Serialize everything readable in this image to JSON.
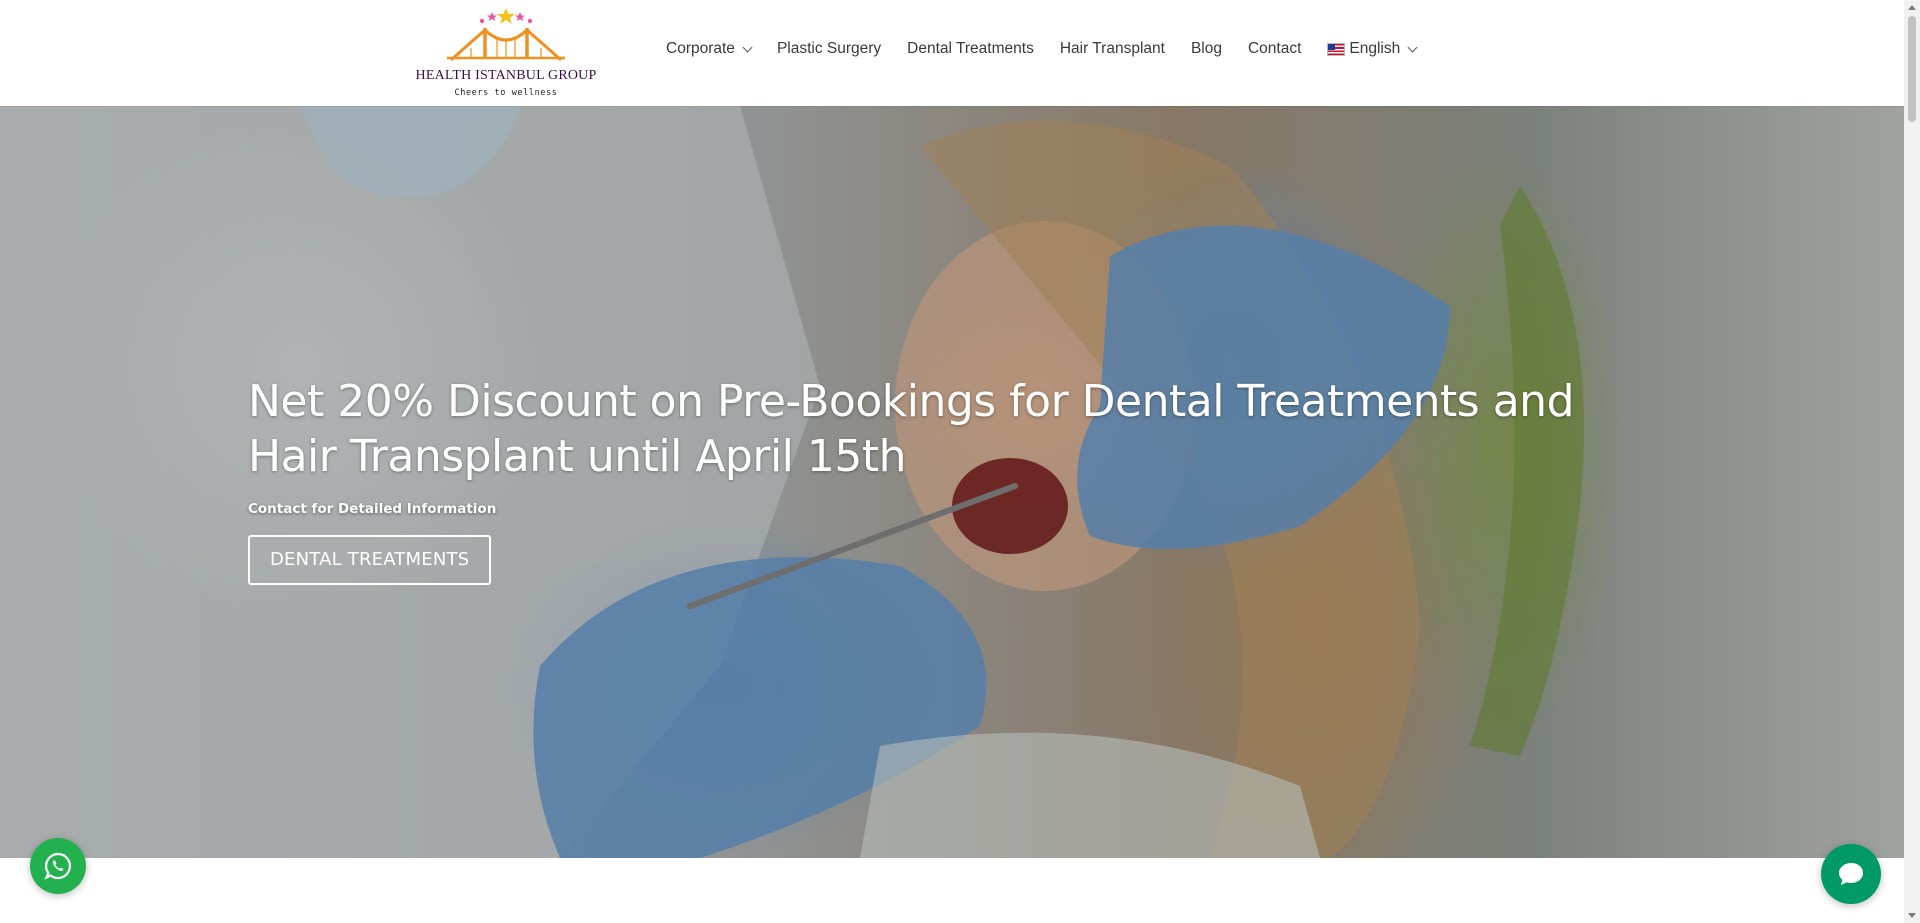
{
  "brand": {
    "name": "HEALTH ISTANBUL GROUP",
    "tagline": "Cheers to wellness",
    "logo_icon": "bridge-with-stars-logo",
    "colors": {
      "orange": "#f0901e",
      "purple": "#7b2d84",
      "pink": "#e8559a",
      "gold": "#f2c21a"
    }
  },
  "nav": {
    "items": [
      {
        "label": "Corporate",
        "has_dropdown": true
      },
      {
        "label": "Plastic Surgery",
        "has_dropdown": false
      },
      {
        "label": "Dental Treatments",
        "has_dropdown": false
      },
      {
        "label": "Hair Transplant",
        "has_dropdown": false
      },
      {
        "label": "Blog",
        "has_dropdown": false
      },
      {
        "label": "Contact",
        "has_dropdown": false
      }
    ],
    "language": {
      "label": "English",
      "icon": "us-flag-icon",
      "has_dropdown": true
    }
  },
  "hero": {
    "title": "Net 20% Discount on Pre-Bookings for Dental Treatments and Hair Transplant until April 15th",
    "subtitle": "Contact for Detailed Information",
    "button_label": "DENTAL TREATMENTS",
    "background": "photo: dentist in blue gloves examining a smiling woman's teeth"
  },
  "floating": {
    "whatsapp": {
      "icon": "whatsapp-icon",
      "color": "#23b14f"
    },
    "chat": {
      "icon": "chat-bubble-icon",
      "color": "#009a66"
    }
  }
}
